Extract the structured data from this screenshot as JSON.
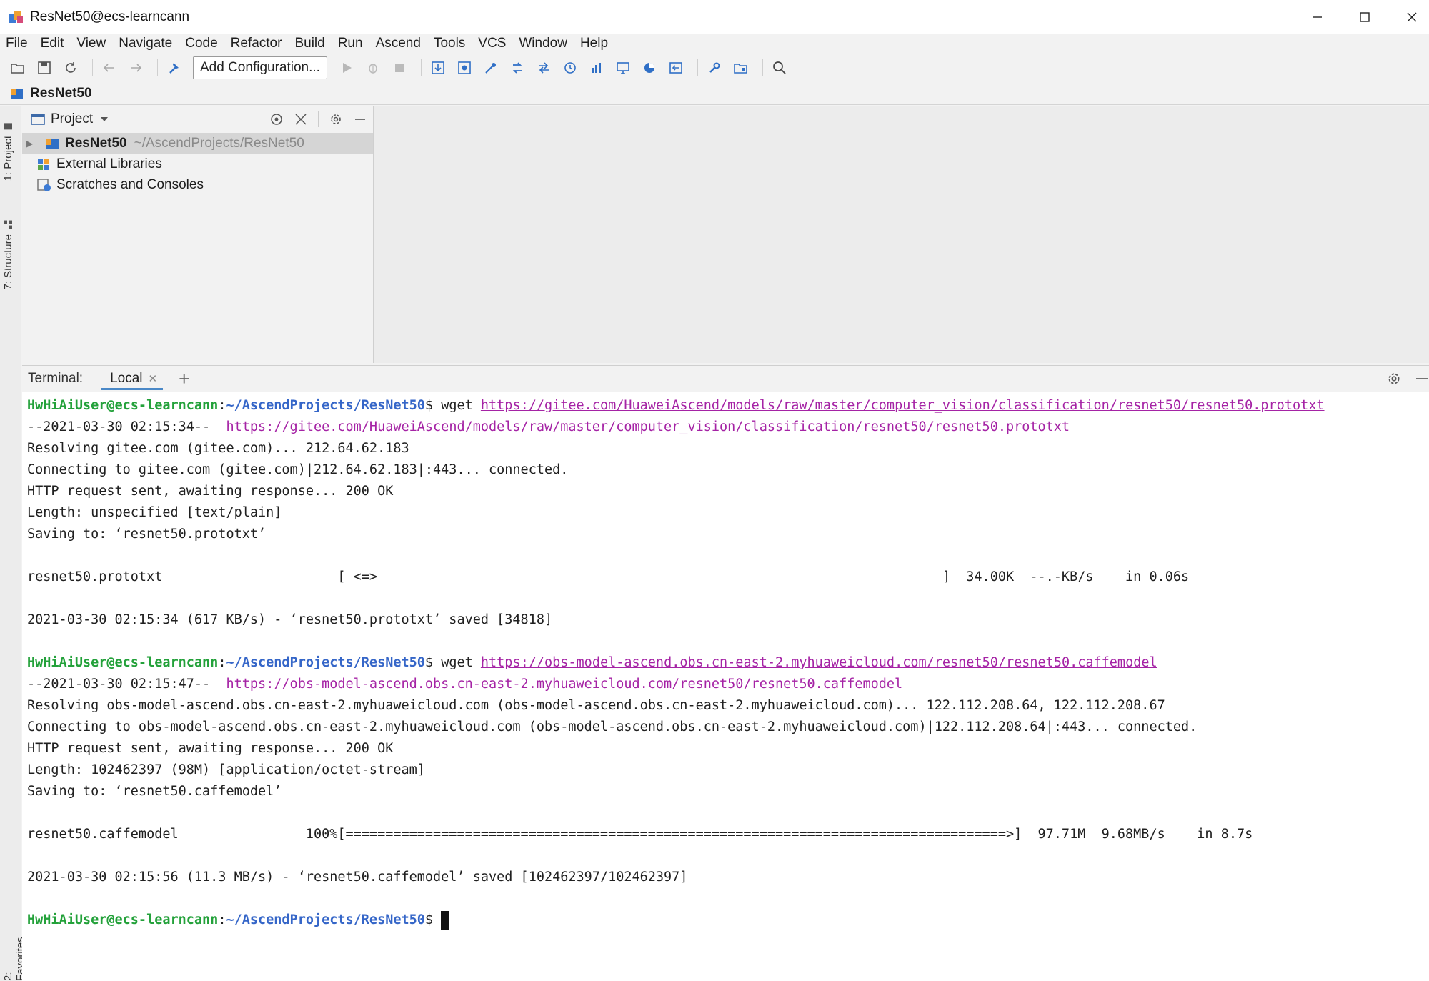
{
  "window": {
    "title": "ResNet50@ecs-learncann"
  },
  "menu": [
    "File",
    "Edit",
    "View",
    "Navigate",
    "Code",
    "Refactor",
    "Build",
    "Run",
    "Ascend",
    "Tools",
    "VCS",
    "Window",
    "Help"
  ],
  "toolbar": {
    "add_configuration": "Add Configuration..."
  },
  "navbar": {
    "project": "ResNet50"
  },
  "side_tabs": {
    "project": "1: Project",
    "structure": "7: Structure",
    "favorites": "2: Favorites"
  },
  "project_panel": {
    "title": "Project",
    "root": {
      "name": "ResNet50",
      "path": "~/AscendProjects/ResNet50"
    },
    "items": [
      "External Libraries",
      "Scratches and Consoles"
    ]
  },
  "terminal": {
    "label": "Terminal:",
    "tab": "Local",
    "prompt_user": "HwHiAiUser@ecs-learncann",
    "prompt_path": "~/AscendProjects/ResNet50",
    "lines": {
      "cmd1": "wget",
      "url1": "https://gitee.com/HuaweiAscend/models/raw/master/computer_vision/classification/resnet50/resnet50.prototxt",
      "ts1": "--2021-03-30 02:15:34--  ",
      "resolve1": "Resolving gitee.com (gitee.com)... 212.64.62.183",
      "connect1": "Connecting to gitee.com (gitee.com)|212.64.62.183|:443... connected.",
      "http1": "HTTP request sent, awaiting response... 200 OK",
      "length1": "Length: unspecified [text/plain]",
      "saving1": "Saving to: ‘resnet50.prototxt’",
      "progress1": "resnet50.prototxt                      [ <=>                                                                       ]  34.00K  --.-KB/s    in 0.06s",
      "saved1": "2021-03-30 02:15:34 (617 KB/s) - ‘resnet50.prototxt’ saved [34818]",
      "url2": "https://obs-model-ascend.obs.cn-east-2.myhuaweicloud.com/resnet50/resnet50.caffemodel",
      "ts2": "--2021-03-30 02:15:47--  ",
      "resolve2": "Resolving obs-model-ascend.obs.cn-east-2.myhuaweicloud.com (obs-model-ascend.obs.cn-east-2.myhuaweicloud.com)... 122.112.208.64, 122.112.208.67",
      "connect2": "Connecting to obs-model-ascend.obs.cn-east-2.myhuaweicloud.com (obs-model-ascend.obs.cn-east-2.myhuaweicloud.com)|122.112.208.64|:443... connected.",
      "http2": "HTTP request sent, awaiting response... 200 OK",
      "length2": "Length: 102462397 (98M) [application/octet-stream]",
      "saving2": "Saving to: ‘resnet50.caffemodel’",
      "progress2": "resnet50.caffemodel                100%[===================================================================================>]  97.71M  9.68MB/s    in 8.7s",
      "saved2": "2021-03-30 02:15:56 (11.3 MB/s) - ‘resnet50.caffemodel’ saved [102462397/102462397]",
      "prompt_tail": "$ "
    }
  },
  "colors": {
    "prompt_user": "#23a13a",
    "prompt_path": "#3566c8",
    "link": "#a523a5",
    "tab_underline": "#4a88c7"
  }
}
